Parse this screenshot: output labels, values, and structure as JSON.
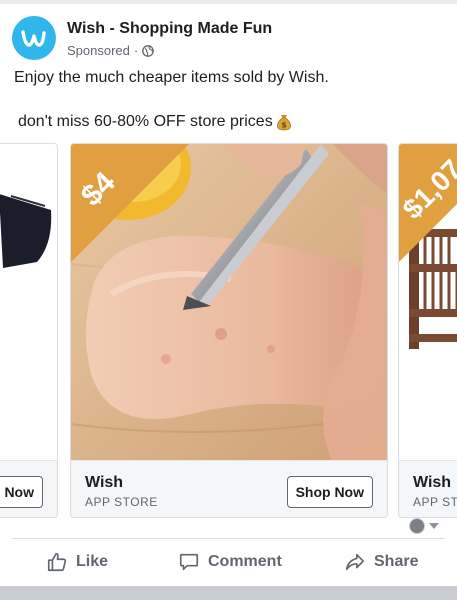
{
  "post": {
    "page_name": "Wish - Shopping Made Fun",
    "sponsored": "Sponsored",
    "separator": "·",
    "text_line1": "Enjoy the much cheaper items sold by Wish.",
    "text_line2": "don't miss 60-80% OFF store prices"
  },
  "icons": {
    "avatar": "wish-logo-icon",
    "globe": "globe-icon",
    "moneybag": "money-bag-icon",
    "like": "thumbs-up-icon",
    "comment": "comment-bubble-icon",
    "share": "share-arrow-icon"
  },
  "carousel": {
    "cards": [
      {
        "title": "",
        "subtitle": "",
        "button": "Shop Now",
        "price": ""
      },
      {
        "title": "Wish",
        "subtitle": "APP STORE",
        "button": "Shop Now",
        "price": "$4"
      },
      {
        "title": "Wish",
        "subtitle": "APP ST",
        "button": "",
        "price": "$1,07"
      }
    ]
  },
  "actions": {
    "like": "Like",
    "comment": "Comment",
    "share": "Share"
  },
  "colors": {
    "brand_blue": "#2fb7ec",
    "price_tag": "#e0a040",
    "text_primary": "#1c1e21",
    "text_secondary": "#606770"
  }
}
